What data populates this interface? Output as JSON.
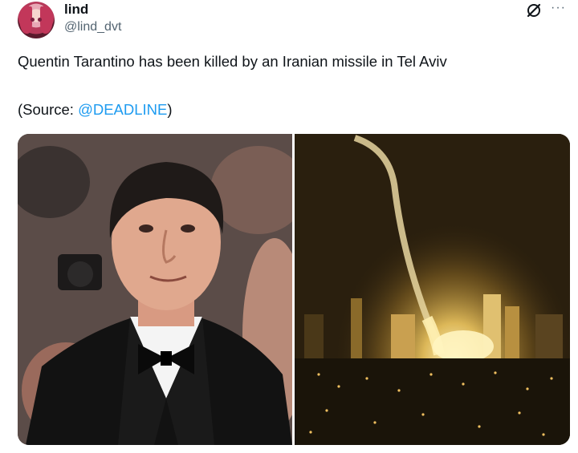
{
  "post": {
    "display_name": "lind",
    "handle": "@lind_dvt",
    "text": "Quentin Tarantino has been killed by an Iranian missile in Tel Aviv",
    "source_prefix": "(Source: ",
    "source_mention": "@DEADLINE",
    "source_suffix": ")",
    "more_glyph": "···"
  },
  "icons": {
    "avatar": "profile-avatar-anime-girl",
    "grok": "grok-icon",
    "more": "more-options-icon"
  },
  "media": {
    "left": "photo-man-in-tuxedo-red-carpet",
    "right": "photo-night-city-missile-explosion"
  },
  "colors": {
    "text": "#0f1419",
    "secondary": "#536471",
    "link": "#1d9bf0"
  }
}
